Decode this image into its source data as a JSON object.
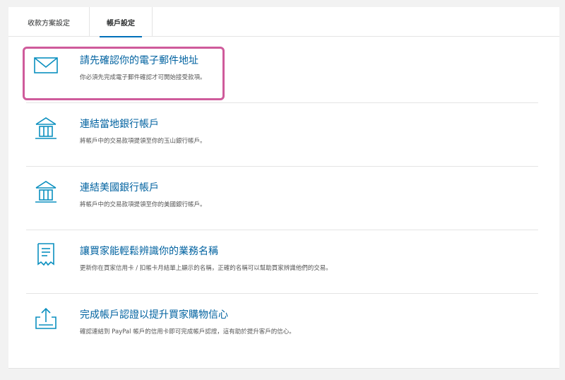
{
  "tabs": [
    {
      "label": "收款方案設定",
      "active": false
    },
    {
      "label": "帳戶設定",
      "active": true
    }
  ],
  "items": [
    {
      "icon": "envelope-icon",
      "title": "請先確認你的電子郵件地址",
      "desc": "你必須先完成電子郵件確認才可開始接受款項。"
    },
    {
      "icon": "bank-icon",
      "title": "連結當地銀行帳戶",
      "desc": "將帳戶中的交易款項提領至你的玉山銀行帳戶。"
    },
    {
      "icon": "bank-icon",
      "title": "連結美國銀行帳戶",
      "desc": "將帳戶中的交易款項提領至你的美國銀行帳戶。"
    },
    {
      "icon": "receipt-icon",
      "title": "讓買家能輕鬆辨識你的業務名稱",
      "desc": "更新你在買家信用卡 / 扣帳卡月結單上顯示的名稱，正確的名稱可以幫助買家辨識他們的交易。"
    },
    {
      "icon": "upload-box-icon",
      "title": "完成帳戶認證以提升買家購物信心",
      "desc": "確認連結到 PayPal 帳戶的信用卡即可完成帳戶認證，這有助於提升客戶的信心。"
    }
  ],
  "colors": {
    "accent": "#0070ba",
    "link": "#0062a0",
    "highlight": "#cf5b9b",
    "icon": "#0a8fbf"
  }
}
